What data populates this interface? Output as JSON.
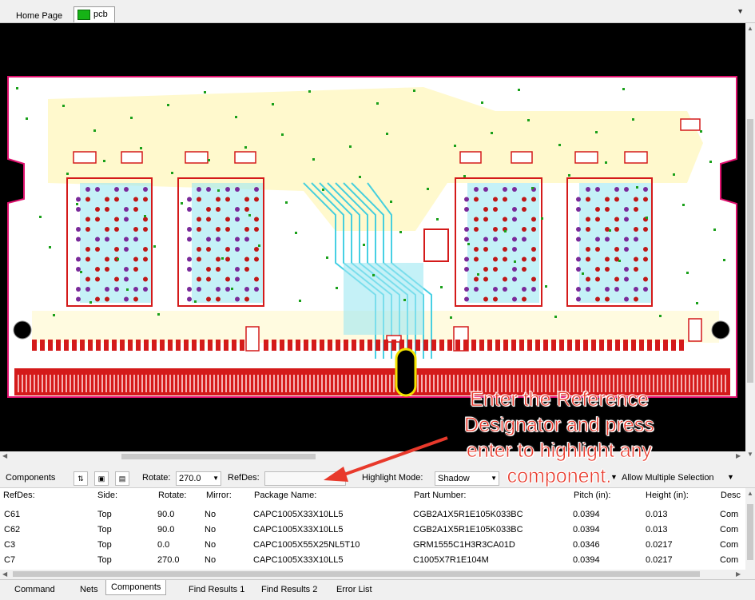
{
  "document_tabs": {
    "home": "Home Page",
    "pcb": "pcb"
  },
  "toolbar": {
    "panel_label": "Components",
    "rotate_label": "Rotate:",
    "rotate_value": "270.0",
    "refdes_label": "RefDes:",
    "refdes_value": "",
    "highlight_label": "Highlight Mode:",
    "highlight_value": "Shadow",
    "multi_select_label": "Allow Multiple Selection"
  },
  "table": {
    "columns": [
      "RefDes:",
      "Side:",
      "Rotate:",
      "Mirror:",
      "Package Name:",
      "Part Number:",
      "Pitch (in):",
      "Height (in):",
      "Desc"
    ],
    "rows": [
      [
        "C61",
        "Top",
        "90.0",
        "No",
        "CAPC1005X33X10LL5",
        "CGB2A1X5R1E105K033BC",
        "0.0394",
        "0.013",
        "Com"
      ],
      [
        "C62",
        "Top",
        "90.0",
        "No",
        "CAPC1005X33X10LL5",
        "CGB2A1X5R1E105K033BC",
        "0.0394",
        "0.013",
        "Com"
      ],
      [
        "C3",
        "Top",
        "0.0",
        "No",
        "CAPC1005X55X25NL5T10",
        "GRM1555C1H3R3CA01D",
        "0.0346",
        "0.0217",
        "Com"
      ],
      [
        "C7",
        "Top",
        "270.0",
        "No",
        "CAPC1005X33X10LL5",
        "C1005X7R1E104M",
        "0.0394",
        "0.0217",
        "Com"
      ]
    ]
  },
  "bottom_tabs": [
    "Command",
    "Nets",
    "Components",
    "Find Results 1",
    "Find Results 2",
    "Error List"
  ],
  "annotation": {
    "line1": "Enter the Reference",
    "line2": "Designator and press",
    "line3": "enter to highlight any",
    "line4": "component."
  },
  "colors": {
    "pad_red": "#d41a1a",
    "trace_cyan": "#27c8e0",
    "outline_magenta": "#e0106e",
    "silk_yellow": "#fff8c8"
  }
}
